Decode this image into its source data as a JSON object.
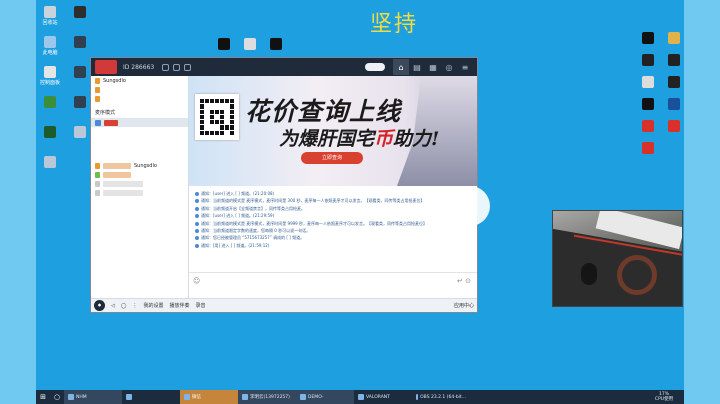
{
  "desktop": {
    "title": "坚持",
    "left_icons": [
      {
        "label": "回收站",
        "color": "#c9d3dc"
      },
      {
        "label": "",
        "color": "#2d2d2d"
      },
      {
        "label": "此电脑",
        "color": "#9bc7ea"
      },
      {
        "label": "",
        "color": "#304050"
      },
      {
        "label": "控制面板",
        "color": "#e5e5e5"
      },
      {
        "label": "",
        "color": "#304050"
      },
      {
        "label": "",
        "color": "#3b8f3b"
      },
      {
        "label": "",
        "color": "#304050"
      },
      {
        "label": "",
        "color": "#1d5c2a"
      },
      {
        "label": "",
        "color": "#b9c7d6"
      },
      {
        "label": "",
        "color": "#b9c7d6"
      }
    ],
    "top_icons": [
      {
        "label": "",
        "color": "#111"
      },
      {
        "label": "",
        "color": "#ddd"
      },
      {
        "label": "",
        "color": "#111"
      }
    ],
    "right_icons": [
      {
        "label": "",
        "color": "#111"
      },
      {
        "label": "",
        "color": "#e0b24a"
      },
      {
        "label": "",
        "color": "#222"
      },
      {
        "label": "",
        "color": "#222"
      },
      {
        "label": "",
        "color": "#ddd"
      },
      {
        "label": "",
        "color": "#222"
      },
      {
        "label": "",
        "color": "#111"
      },
      {
        "label": "",
        "color": "#1a4f9a"
      },
      {
        "label": "",
        "color": "#d8312a"
      },
      {
        "label": "",
        "color": "#d8312a"
      },
      {
        "label": "",
        "color": "#d8312a"
      }
    ]
  },
  "window": {
    "id_text": "ID 286663",
    "left_panel": {
      "rows": [
        {
          "label": "Sungsdlo",
          "color": "#e79b2e"
        },
        {
          "label": "",
          "color": "#e79b2e"
        },
        {
          "label": "",
          "color": "#e79b2e"
        }
      ],
      "mode_label": "麦序模式",
      "channel_label": "",
      "members": [
        {
          "label": "Sungsdlo",
          "color": "#e79b2e"
        },
        {
          "label": "",
          "color": "#6cbf4a"
        },
        {
          "label": "",
          "color": "#c9c9c9"
        },
        {
          "label": "",
          "color": "#c9c9c9"
        }
      ]
    },
    "banner": {
      "line1": "花价查询上线",
      "line2_prefix": "为爆肝国宅",
      "line2_em": "币",
      "line2_suffix": "助力!",
      "button": "立即查询"
    },
    "chat_messages": [
      "通知：[user] 进入 [ ] 频道。(21:20:08)",
      "通知：当前频道的模式是 麦序模式，麦序时间是 300 秒，麦序每一人依照麦序才可以发言。【观看类，同传等类占用抢麦位】",
      "通知：当前频道开启【全频道禁言】，同传等类占用抢麦。",
      "通知：[user] 进入 [ ] 频道。(21:29:59)",
      "通知：当前频道的模式是 麦序模式，麦序时间是 9999 秒，麦序每一人依照麦序才可以发言。【观看类，同传等类占用抢麦位】",
      "通知：当前频道限定字数的速度，您每隔 0 秒可以说一句话。",
      "通知：您已经被管理员 “5715673257” 调成的 [ ] 频道。",
      "通知：[用] 进入 [ ] 频道。(21:59:12)"
    ],
    "bottom_bar": {
      "items": [
        "我的设置",
        "播放伴奏",
        "录音"
      ],
      "right": "应用中心"
    }
  },
  "taskbar": {
    "items": [
      {
        "label": "NHM",
        "style": "hl"
      },
      {
        "label": "",
        "style": "normal"
      },
      {
        "label": "微信",
        "style": "orange"
      },
      {
        "label": "李明云(13972257)",
        "style": "hl"
      },
      {
        "label": "DEMO-",
        "style": "hl"
      },
      {
        "label": "VALORANT",
        "style": "normal"
      },
      {
        "label": "OBS 23.2.1 (64-bit...",
        "style": "normal"
      }
    ],
    "tray_top": "17%",
    "tray_bottom": "CPU使用"
  }
}
